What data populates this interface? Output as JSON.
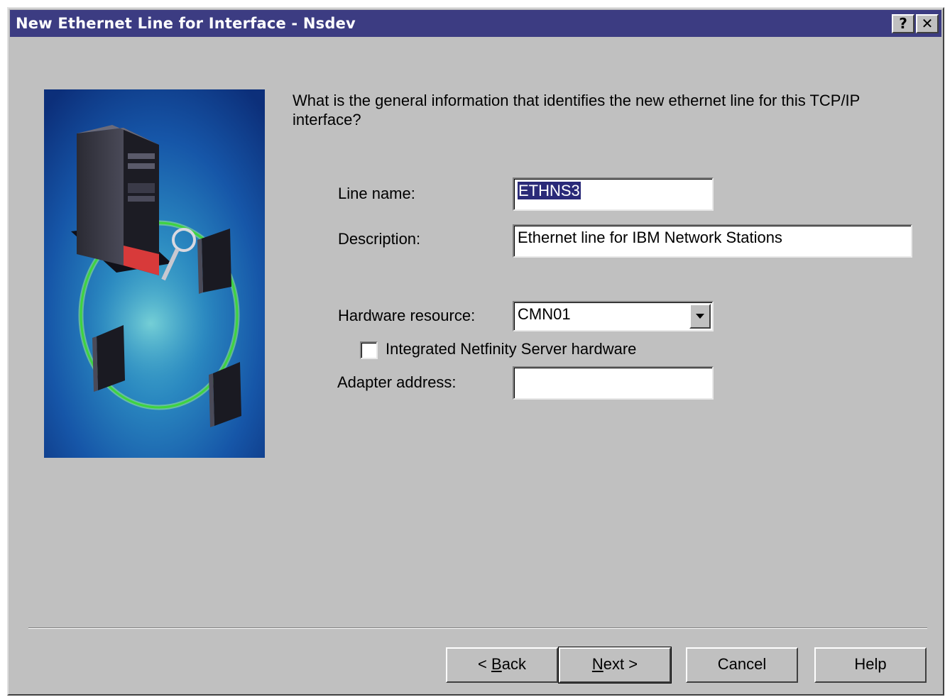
{
  "window": {
    "title": "New Ethernet Line for Interface - Nsdev",
    "help_glyph": "?",
    "close_glyph": "✕"
  },
  "question": "What is the general information that identifies the new ethernet line for this TCP/IP interface?",
  "fields": {
    "line_name": {
      "label": "Line name:",
      "value": "ETHNS3"
    },
    "description": {
      "label": "Description:",
      "value": "Ethernet line for IBM Network Stations"
    },
    "hardware_resource": {
      "label": "Hardware resource:",
      "value": "CMN01"
    },
    "integrated_netfinity": {
      "label": "Integrated Netfinity Server hardware",
      "checked": false
    },
    "adapter_address": {
      "label": "Adapter address:",
      "value": ""
    }
  },
  "buttons": {
    "back": {
      "prefix": "< ",
      "mnemonic": "B",
      "rest": "ack"
    },
    "next": {
      "mnemonic": "N",
      "rest": "ext >"
    },
    "cancel": "Cancel",
    "help": "Help"
  },
  "icons": [
    "help-title-icon",
    "close-title-icon",
    "dropdown-arrow-icon",
    "server-illustration"
  ],
  "colors": {
    "title_bar": "#3c3c82",
    "dialog_face": "#c0c0c0",
    "selection": "#2a2a78"
  }
}
